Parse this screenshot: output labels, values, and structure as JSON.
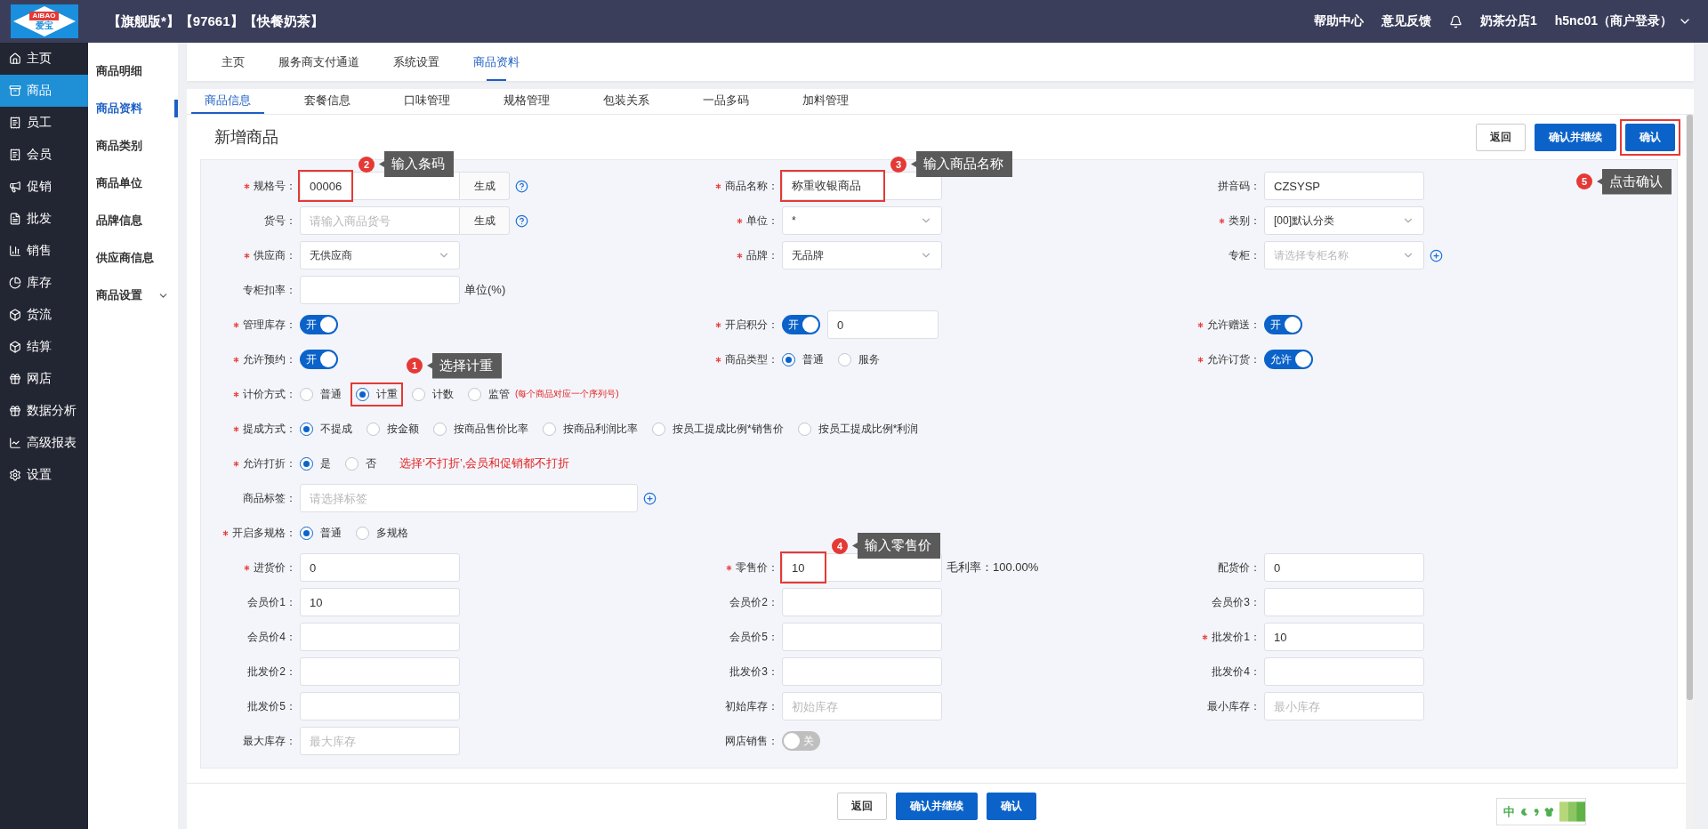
{
  "app": {
    "logo_text": "AIBAO",
    "logo_subtext": "爱宝",
    "title": "【旗舰版*】【97661】【快餐奶茶】",
    "links": [
      "帮助中心",
      "意见反馈"
    ],
    "store": "奶茶分店1",
    "user": "h5nc01（商户登录）"
  },
  "sidebar": {
    "items": [
      {
        "label": "主页",
        "selected": false
      },
      {
        "label": "商品",
        "selected": true
      },
      {
        "label": "员工",
        "selected": false
      },
      {
        "label": "会员",
        "selected": false
      },
      {
        "label": "促销",
        "selected": false
      },
      {
        "label": "批发",
        "selected": false
      },
      {
        "label": "销售",
        "selected": false
      },
      {
        "label": "库存",
        "selected": false
      },
      {
        "label": "货流",
        "selected": false
      },
      {
        "label": "结算",
        "selected": false
      },
      {
        "label": "网店",
        "selected": false
      },
      {
        "label": "数据分析",
        "selected": false
      },
      {
        "label": "高级报表",
        "selected": false
      },
      {
        "label": "设置",
        "selected": false
      }
    ]
  },
  "subnav": {
    "items": [
      {
        "label": "商品明细",
        "selected": false,
        "expandable": false
      },
      {
        "label": "商品资料",
        "selected": true,
        "expandable": false
      },
      {
        "label": "商品类别",
        "selected": false,
        "expandable": false
      },
      {
        "label": "商品单位",
        "selected": false,
        "expandable": false
      },
      {
        "label": "品牌信息",
        "selected": false,
        "expandable": false
      },
      {
        "label": "供应商信息",
        "selected": false,
        "expandable": false
      },
      {
        "label": "商品设置",
        "selected": false,
        "expandable": true
      }
    ]
  },
  "top_tabs": [
    {
      "label": "主页",
      "selected": false
    },
    {
      "label": "服务商支付通道",
      "selected": false
    },
    {
      "label": "系统设置",
      "selected": false
    },
    {
      "label": "商品资料",
      "selected": true
    }
  ],
  "sub_tabs": [
    {
      "label": "商品信息",
      "selected": true
    },
    {
      "label": "套餐信息",
      "selected": false
    },
    {
      "label": "口味管理",
      "selected": false
    },
    {
      "label": "规格管理",
      "selected": false
    },
    {
      "label": "包装关系",
      "selected": false
    },
    {
      "label": "一品多码",
      "selected": false
    },
    {
      "label": "加料管理",
      "selected": false
    }
  ],
  "page": {
    "title": "新增商品",
    "buttons": [
      {
        "label": "返回",
        "kind": "secondary"
      },
      {
        "label": "确认并继续",
        "kind": "primary"
      },
      {
        "label": "确认",
        "kind": "primary",
        "callout": {
          "number": "5",
          "text": "点击确认"
        }
      }
    ]
  },
  "form": {
    "rows": [
      {
        "fields": [
          {
            "label": "规格号：",
            "required": true,
            "kind": "text",
            "value": "00006",
            "button": "生成",
            "help": true,
            "callout": {
              "number": "2",
              "text": "输入条码"
            }
          },
          {
            "label": "商品名称：",
            "required": true,
            "kind": "text",
            "value": "称重收银商品",
            "callout": {
              "number": "3",
              "text": "输入商品名称"
            }
          },
          {
            "label": "拼音码：",
            "required": false,
            "kind": "text",
            "value": "CZSYSP"
          }
        ]
      },
      {
        "fields": [
          {
            "label": "货号：",
            "required": false,
            "kind": "text",
            "placeholder": "请输入商品货号",
            "button": "生成",
            "help": true
          },
          {
            "label": "单位：",
            "required": true,
            "kind": "select",
            "value": "*"
          },
          {
            "label": "类别：",
            "required": true,
            "kind": "select",
            "value": "[00]默认分类"
          }
        ]
      },
      {
        "fields": [
          {
            "label": "供应商：",
            "required": true,
            "kind": "select",
            "value": "无供应商"
          },
          {
            "label": "品牌：",
            "required": true,
            "kind": "select",
            "value": "无品牌"
          },
          {
            "label": "专柜：",
            "required": false,
            "kind": "select",
            "placeholder": "请选择专柜名称",
            "add": true
          }
        ]
      },
      {
        "fields": [
          {
            "label": "专柜扣率：",
            "required": false,
            "kind": "text",
            "suffix": "单位(%)"
          }
        ]
      },
      {
        "fields": [
          {
            "label": "管理库存：",
            "required": true,
            "kind": "toggle",
            "on": true,
            "text": "开"
          },
          {
            "label": "开启积分：",
            "required": true,
            "kind": "toggle",
            "on": true,
            "text": "开",
            "input_value": "0"
          },
          {
            "label": "允许赠送：",
            "required": true,
            "kind": "toggle",
            "on": true,
            "text": "开"
          }
        ]
      },
      {
        "fields": [
          {
            "label": "允许预约：",
            "required": true,
            "kind": "toggle",
            "on": true,
            "text": "开"
          },
          {
            "label": "商品类型：",
            "required": true,
            "kind": "radio",
            "options": [
              {
                "label": "普通",
                "selected": true
              },
              {
                "label": "服务",
                "selected": false
              }
            ]
          },
          {
            "label": "允许订货：",
            "required": true,
            "kind": "toggle",
            "on": true,
            "text": "允许"
          }
        ]
      },
      {
        "fields": [
          {
            "label": "计价方式：",
            "required": true,
            "kind": "radio",
            "options": [
              {
                "label": "普通",
                "selected": false
              },
              {
                "label": "计重",
                "selected": true,
                "callout": {
                  "number": "1",
                  "text": "选择计重"
                }
              },
              {
                "label": "计数",
                "selected": false
              },
              {
                "label": "监管",
                "selected": false
              }
            ],
            "note": {
              "kind": "fine",
              "text": "(每个商品对应一个序列号)"
            }
          }
        ]
      },
      {
        "fields": [
          {
            "label": "提成方式：",
            "required": true,
            "kind": "radio",
            "options": [
              {
                "label": "不提成",
                "selected": true
              },
              {
                "label": "按金额",
                "selected": false
              },
              {
                "label": "按商品售价比率",
                "selected": false
              },
              {
                "label": "按商品利润比率",
                "selected": false
              },
              {
                "label": "按员工提成比例*销售价",
                "selected": false
              },
              {
                "label": "按员工提成比例*利润",
                "selected": false
              }
            ]
          }
        ]
      },
      {
        "fields": [
          {
            "label": "允许打折：",
            "required": true,
            "kind": "radio",
            "options": [
              {
                "label": "是",
                "selected": true
              },
              {
                "label": "否",
                "selected": false
              }
            ],
            "note": {
              "kind": "warning",
              "text": "选择‘不打折’,会员和促销都不打折"
            }
          }
        ]
      },
      {
        "fields": [
          {
            "label": "商品标签：",
            "required": false,
            "kind": "text",
            "placeholder": "请选择标签",
            "wide": true,
            "add": true
          }
        ]
      },
      {
        "fields": [
          {
            "label": "开启多规格：",
            "required": true,
            "kind": "radio",
            "options": [
              {
                "label": "普通",
                "selected": true
              },
              {
                "label": "多规格",
                "selected": false
              }
            ]
          }
        ]
      },
      {
        "fields": [
          {
            "label": "进货价：",
            "required": true,
            "kind": "text",
            "value": "0"
          },
          {
            "label": "零售价：",
            "required": true,
            "kind": "text",
            "value": "10",
            "suffix": "毛利率：100.00%",
            "callout": {
              "number": "4",
              "text": "输入零售价"
            }
          },
          {
            "label": "配货价：",
            "required": false,
            "kind": "text",
            "value": "0"
          }
        ]
      },
      {
        "fields": [
          {
            "label": "会员价1：",
            "required": false,
            "kind": "text",
            "value": "10"
          },
          {
            "label": "会员价2：",
            "required": false,
            "kind": "text"
          },
          {
            "label": "会员价3：",
            "required": false,
            "kind": "text"
          }
        ]
      },
      {
        "fields": [
          {
            "label": "会员价4：",
            "required": false,
            "kind": "text"
          },
          {
            "label": "会员价5：",
            "required": false,
            "kind": "text"
          },
          {
            "label": "批发价1：",
            "required": true,
            "kind": "text",
            "value": "10"
          }
        ]
      },
      {
        "fields": [
          {
            "label": "批发价2：",
            "required": false,
            "kind": "text"
          },
          {
            "label": "批发价3：",
            "required": false,
            "kind": "text"
          },
          {
            "label": "批发价4：",
            "required": false,
            "kind": "text"
          }
        ]
      },
      {
        "fields": [
          {
            "label": "批发价5：",
            "required": false,
            "kind": "text"
          },
          {
            "label": "初始库存：",
            "required": false,
            "kind": "text",
            "placeholder": "初始库存"
          },
          {
            "label": "最小库存：",
            "required": false,
            "kind": "text",
            "placeholder": "最小库存"
          }
        ]
      },
      {
        "fields": [
          {
            "label": "最大库存：",
            "required": false,
            "kind": "text",
            "placeholder": "最大库存"
          },
          {
            "label": "网店销售：",
            "required": false,
            "kind": "toggle",
            "on": false,
            "text": "关"
          }
        ]
      }
    ]
  },
  "footer": {
    "buttons": [
      {
        "label": "返回",
        "kind": "secondary"
      },
      {
        "label": "确认并继续",
        "kind": "primary"
      },
      {
        "label": "确认",
        "kind": "primary"
      }
    ]
  },
  "ime": {
    "mode": "中"
  }
}
